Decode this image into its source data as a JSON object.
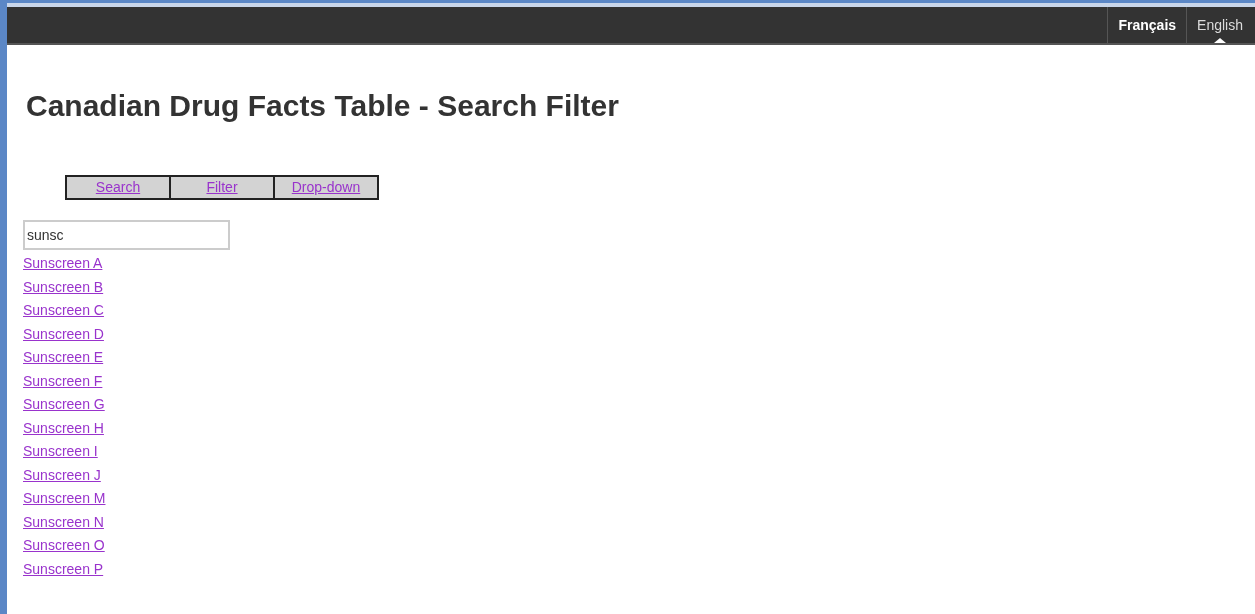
{
  "languages": [
    {
      "label": "Français",
      "selected": false
    },
    {
      "label": "English",
      "selected": true
    }
  ],
  "title": "Canadian Drug Facts Table - Search Filter",
  "tabs": [
    {
      "label": "Search"
    },
    {
      "label": "Filter"
    },
    {
      "label": "Drop-down"
    }
  ],
  "search": {
    "value": "sunsc"
  },
  "results": [
    "Sunscreen A",
    "Sunscreen B",
    "Sunscreen C",
    "Sunscreen D",
    "Sunscreen E",
    "Sunscreen F",
    "Sunscreen G",
    "Sunscreen H",
    "Sunscreen I",
    "Sunscreen J",
    "Sunscreen M",
    "Sunscreen N",
    "Sunscreen O",
    "Sunscreen P"
  ]
}
